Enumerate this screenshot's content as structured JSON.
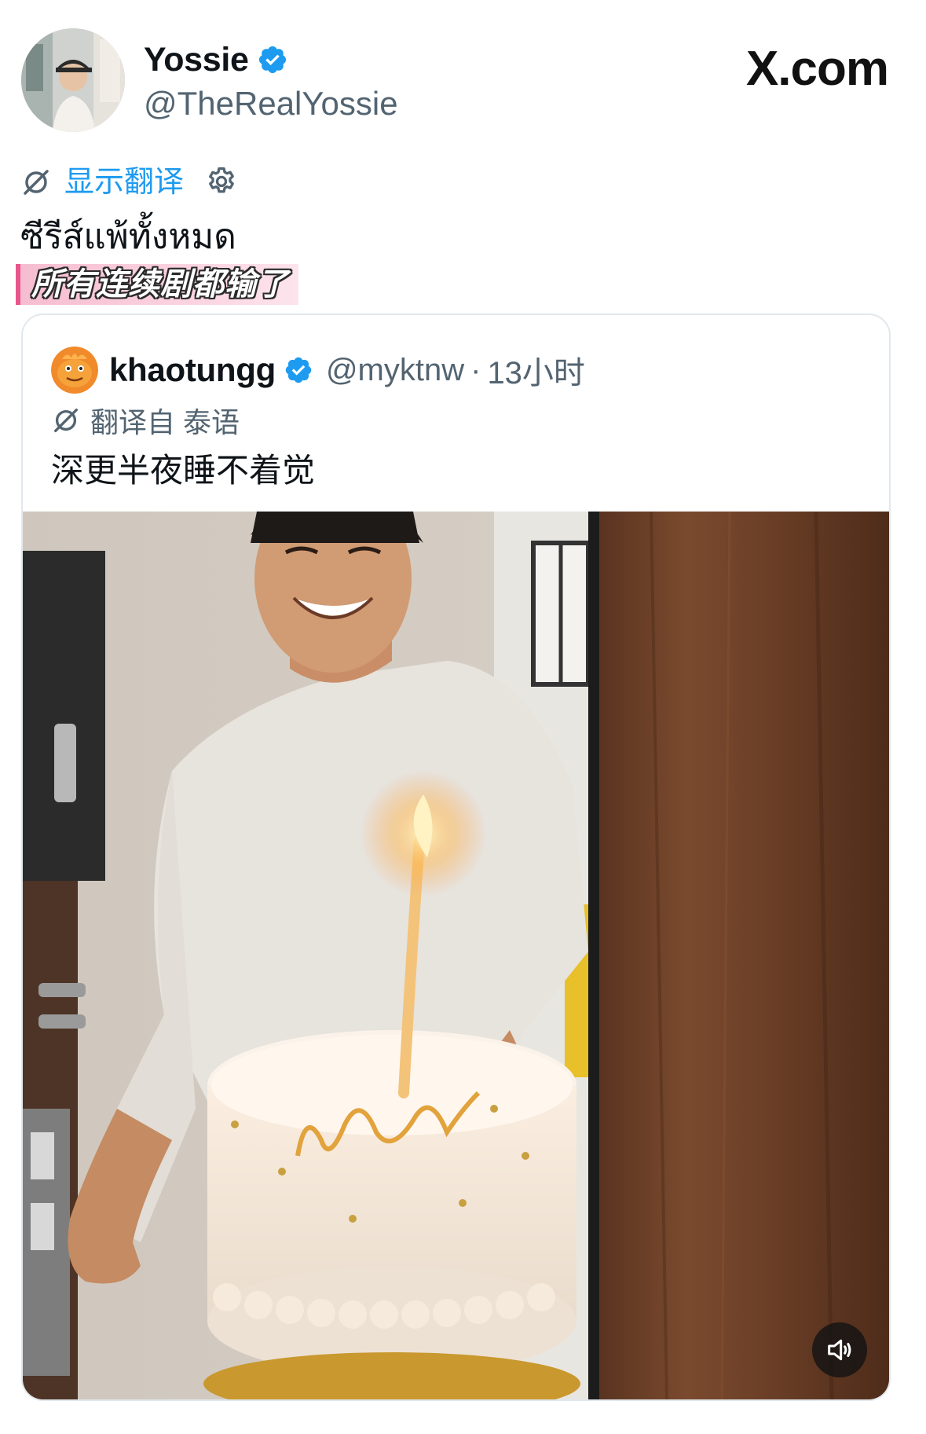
{
  "author": {
    "name": "Yossie",
    "handle": "@TheRealYossie",
    "verified": true,
    "avatar_icon": "profile-photo"
  },
  "watermark": "X.com",
  "translate_bar": {
    "show_translation_label": "显示翻译",
    "no_translate_icon": "translate-off-icon",
    "settings_icon": "gear-icon"
  },
  "tweet": {
    "text": "ซีรีส์แพ้ทั้งหมด",
    "caption_overlay": "所有连续剧都输了"
  },
  "quoted_tweet": {
    "name": "khaotungg",
    "handle": "@myktnw",
    "separator": "·",
    "time": "13小时",
    "verified": true,
    "translated_from": "翻译自 泰语",
    "text": "深更半夜睡不着觉",
    "media": {
      "type": "video",
      "description_icon": "video-thumbnail",
      "mute_icon": "volume-icon"
    }
  },
  "colors": {
    "accent": "#1d9bf0",
    "secondary_text": "#536471",
    "primary_text": "#0f1419",
    "border": "#e1e8ed"
  }
}
